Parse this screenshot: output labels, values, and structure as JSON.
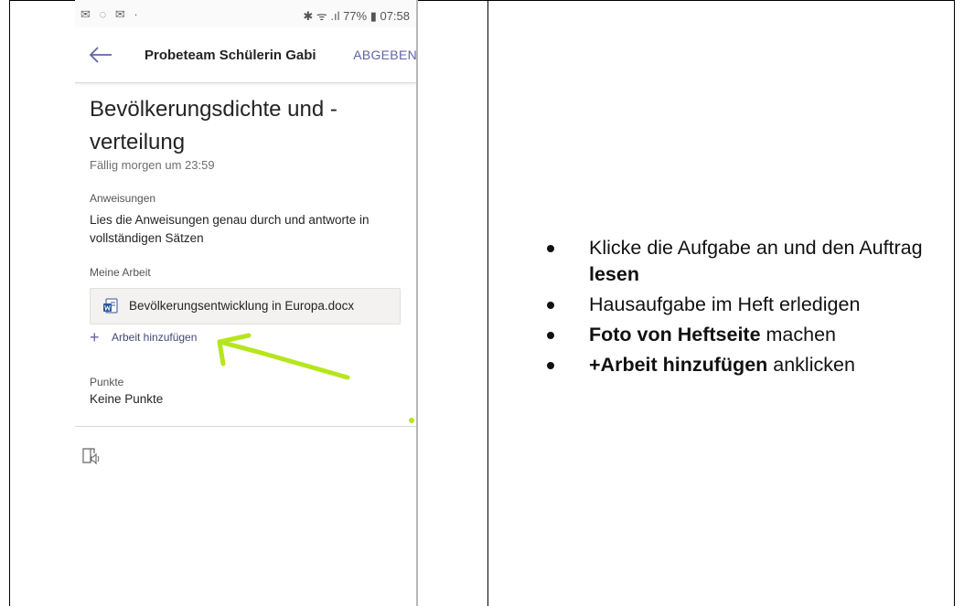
{
  "status_bar": {
    "left_icons": "✉ ◌ ✉ ·",
    "right_text": "✱ ᯤ .ıl 77% ▮ 07:58"
  },
  "app_bar": {
    "title": "Probeteam Schülerin Gabi",
    "submit_label": "ABGEBEN"
  },
  "assignment": {
    "title_line1": "Bevölkerungsdichte und -",
    "title_line2": "verteilung",
    "due": "Fällig morgen um 23:59",
    "instructions_label": "Anweisungen",
    "instructions_text": "Lies die Anweisungen genau durch und antworte in vollständigen Sätzen",
    "my_work_label": "Meine Arbeit",
    "file_name": "Bevölkerungsentwicklung in Europa.docx",
    "add_work_label": "Arbeit hinzufügen",
    "points_label": "Punkte",
    "points_value": "Keine Punkte"
  },
  "icons": {
    "back": "back-arrow-icon",
    "word_file": "word-document-icon",
    "plus": "plus-icon",
    "immersive_reader": "immersive-reader-icon"
  },
  "colors": {
    "accent": "#6264a7",
    "annotation_green": "#b5e61d"
  },
  "instructions_list": [
    {
      "pre": "Klicke die Aufgabe an und den Auftrag ",
      "bold": "lesen",
      "post": ""
    },
    {
      "pre": "Hausaufgabe im Heft erledigen",
      "bold": "",
      "post": ""
    },
    {
      "pre": "",
      "bold": "Foto von Heftseite",
      "post": " machen"
    },
    {
      "pre": "",
      "bold": "+Arbeit hinzufügen",
      "post": " anklicken"
    }
  ]
}
